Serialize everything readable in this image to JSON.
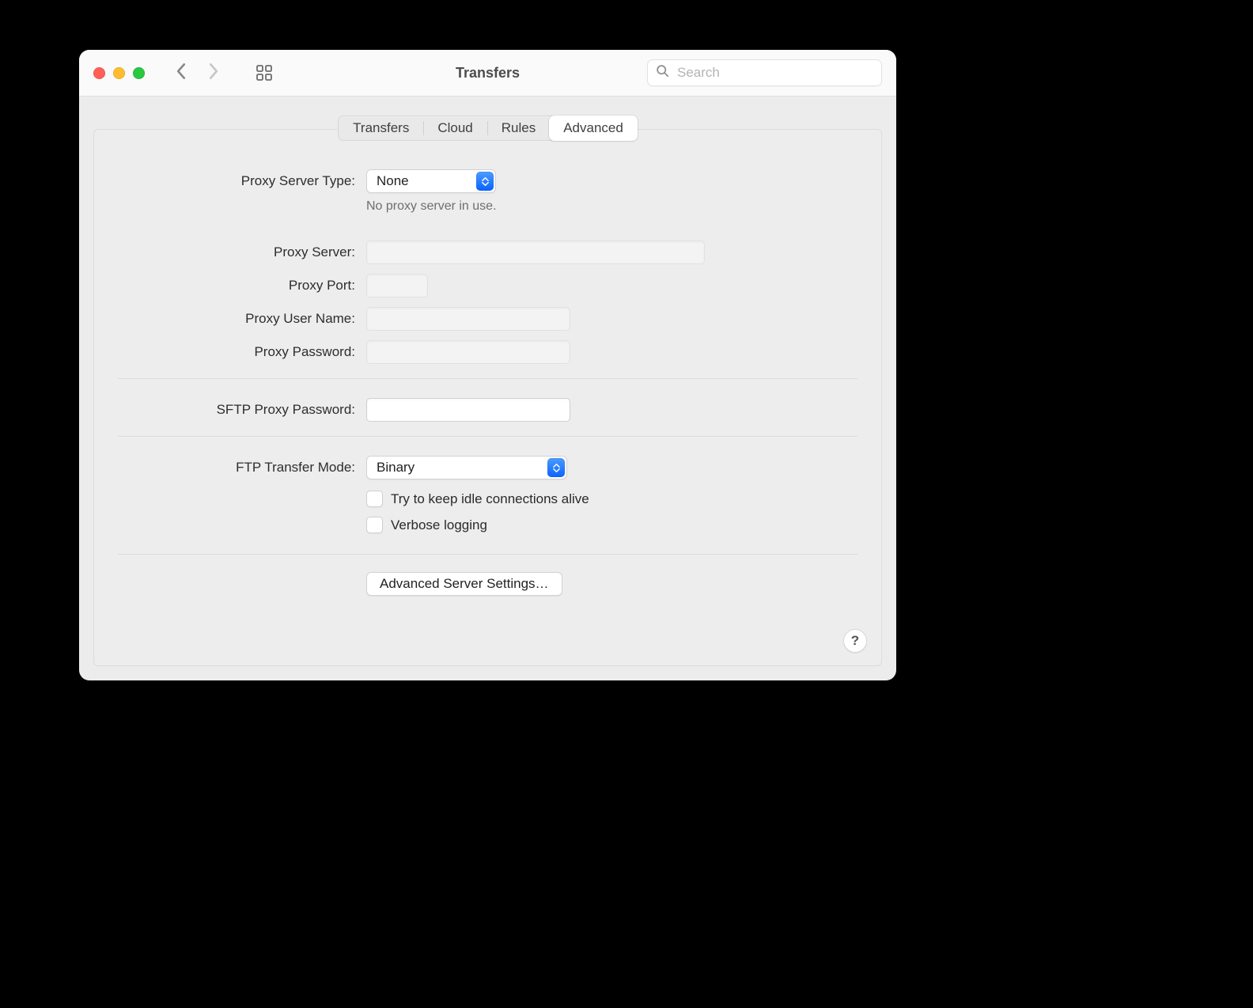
{
  "window": {
    "title": "Transfers",
    "search_placeholder": "Search"
  },
  "tabs": {
    "items": [
      "Transfers",
      "Cloud",
      "Rules",
      "Advanced"
    ],
    "active_index": 3
  },
  "form": {
    "proxy_type": {
      "label": "Proxy Server Type:",
      "value": "None",
      "hint": "No proxy server in use."
    },
    "proxy_server": {
      "label": "Proxy Server:",
      "value": ""
    },
    "proxy_port": {
      "label": "Proxy Port:",
      "value": ""
    },
    "proxy_user": {
      "label": "Proxy User Name:",
      "value": ""
    },
    "proxy_pass": {
      "label": "Proxy Password:",
      "value": ""
    },
    "sftp_pass": {
      "label": "SFTP Proxy Password:",
      "value": ""
    },
    "ftp_mode": {
      "label": "FTP Transfer Mode:",
      "value": "Binary"
    },
    "keep_alive": {
      "label": "Try to keep idle connections alive",
      "checked": false
    },
    "verbose": {
      "label": "Verbose logging",
      "checked": false
    },
    "adv_button": "Advanced Server Settings…",
    "help_label": "?"
  }
}
